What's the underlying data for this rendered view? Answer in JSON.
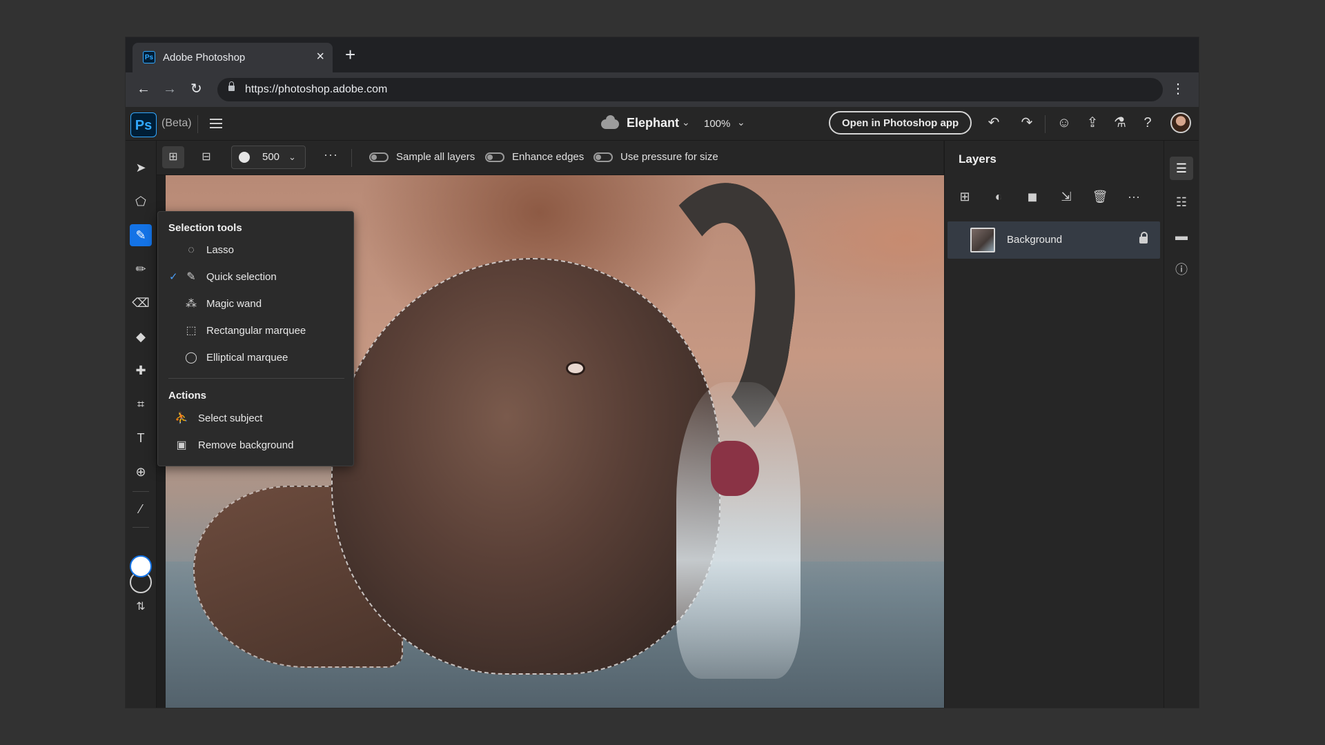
{
  "browser": {
    "tab_title": "Adobe Photoshop",
    "tab_close": "×",
    "new_tab": "+",
    "back": "←",
    "forward": "→",
    "reload": "↻",
    "url": "https://photoshop.adobe.com",
    "menu": "⋮",
    "favicon_text": "Ps"
  },
  "app": {
    "logo": "Ps",
    "beta_label": "(Beta)",
    "document_title": "Elephant",
    "zoom": "100%",
    "open_in_app": "Open in Photoshop app",
    "chevron": "⌄",
    "icons": {
      "undo": "↶",
      "redo": "↷",
      "invite": "☺",
      "share": "⇪",
      "labs": "⚗",
      "help": "?"
    }
  },
  "tools": [
    {
      "name": "move-tool-icon",
      "glyph": "➤"
    },
    {
      "name": "transform-tool-icon",
      "glyph": "⬠"
    },
    {
      "name": "quick-selection-tool-icon",
      "glyph": "✎"
    },
    {
      "name": "brush-tool-icon",
      "glyph": "✏"
    },
    {
      "name": "eraser-tool-icon",
      "glyph": "⌫"
    },
    {
      "name": "paint-bucket-tool-icon",
      "glyph": "◆"
    },
    {
      "name": "healing-brush-tool-icon",
      "glyph": "✚"
    },
    {
      "name": "crop-tool-icon",
      "glyph": "⌗"
    },
    {
      "name": "type-tool-icon",
      "glyph": "T"
    },
    {
      "name": "place-image-tool-icon",
      "glyph": "⊕"
    },
    {
      "name": "eyedropper-tool-icon",
      "glyph": "⁄"
    }
  ],
  "swap_colors": "⇅",
  "options_bar": {
    "brush_size": "500",
    "more": "···",
    "sample_all_layers": "Sample all layers",
    "enhance_edges": "Enhance edges",
    "use_pressure": "Use pressure for size",
    "add_to_selection_glyph": "⊞",
    "subtract_glyph": "⊟",
    "chevron": "⌄"
  },
  "flyout": {
    "section1": "Selection tools",
    "items": [
      {
        "label": "Lasso",
        "glyph": "◌",
        "checked": false
      },
      {
        "label": "Quick selection",
        "glyph": "✎",
        "checked": true
      },
      {
        "label": "Magic wand",
        "glyph": "⁂",
        "checked": false
      },
      {
        "label": "Rectangular marquee",
        "glyph": "⬚",
        "checked": false
      },
      {
        "label": "Elliptical marquee",
        "glyph": "◯",
        "checked": false
      }
    ],
    "check": "✓",
    "section2": "Actions",
    "actions": [
      {
        "label": "Select subject",
        "glyph": "⛹"
      },
      {
        "label": "Remove background",
        "glyph": "▣"
      }
    ]
  },
  "layers_panel": {
    "title": "Layers",
    "tools": [
      "⊞",
      "◐",
      "◼",
      "⇲",
      "🗑",
      "···"
    ],
    "layers": [
      {
        "name": "Background",
        "locked": true
      }
    ]
  },
  "rail": {
    "layers": "☰",
    "properties": "☷",
    "comments": "▬",
    "info": "ⓘ"
  }
}
